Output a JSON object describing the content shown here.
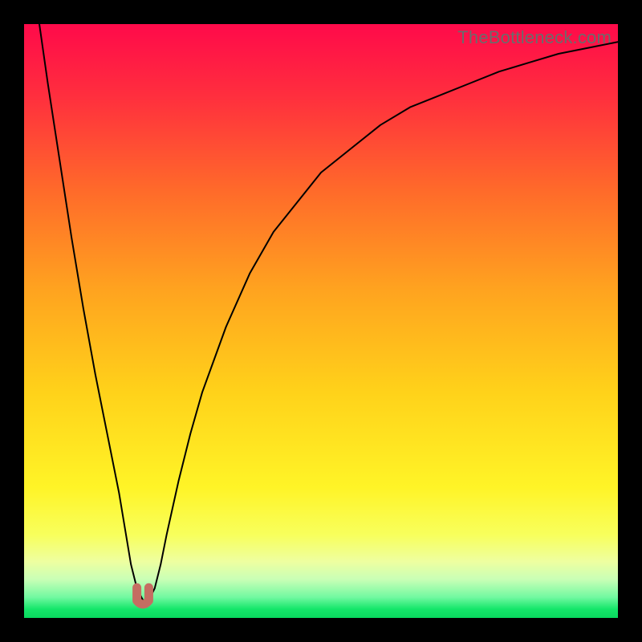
{
  "watermark": "TheBottleneck.com",
  "gradient_stops": [
    {
      "offset": 0.0,
      "color": "#ff0a4a"
    },
    {
      "offset": 0.12,
      "color": "#ff2e3e"
    },
    {
      "offset": 0.28,
      "color": "#ff6a2a"
    },
    {
      "offset": 0.45,
      "color": "#ffa41f"
    },
    {
      "offset": 0.62,
      "color": "#ffd21a"
    },
    {
      "offset": 0.78,
      "color": "#fff427"
    },
    {
      "offset": 0.86,
      "color": "#f8ff5c"
    },
    {
      "offset": 0.905,
      "color": "#eeffa0"
    },
    {
      "offset": 0.935,
      "color": "#c9ffb6"
    },
    {
      "offset": 0.965,
      "color": "#72f9a1"
    },
    {
      "offset": 0.985,
      "color": "#15e66a"
    },
    {
      "offset": 1.0,
      "color": "#09d95f"
    }
  ],
  "chart_data": {
    "type": "line",
    "title": "",
    "xlabel": "",
    "ylabel": "",
    "xlim": [
      0,
      100
    ],
    "ylim": [
      0,
      100
    ],
    "grid": false,
    "legend": false,
    "series": [
      {
        "name": "curve",
        "x": [
          0,
          2,
          4,
          6,
          8,
          10,
          12,
          14,
          16,
          17,
          18,
          19,
          20,
          21,
          22,
          23,
          24,
          26,
          28,
          30,
          34,
          38,
          42,
          46,
          50,
          55,
          60,
          65,
          70,
          75,
          80,
          85,
          90,
          95,
          100
        ],
        "values": [
          118,
          104,
          90,
          77,
          64,
          52,
          41,
          31,
          21,
          15,
          9,
          5,
          3,
          3,
          5,
          9,
          14,
          23,
          31,
          38,
          49,
          58,
          65,
          70,
          75,
          79,
          83,
          86,
          88,
          90,
          92,
          93.5,
          95,
          96,
          97
        ]
      },
      {
        "name": "marker",
        "marker_shape": "u",
        "marker_color": "#c56e62",
        "x": [
          19,
          21
        ],
        "values": [
          4.5,
          4.5
        ]
      }
    ]
  }
}
